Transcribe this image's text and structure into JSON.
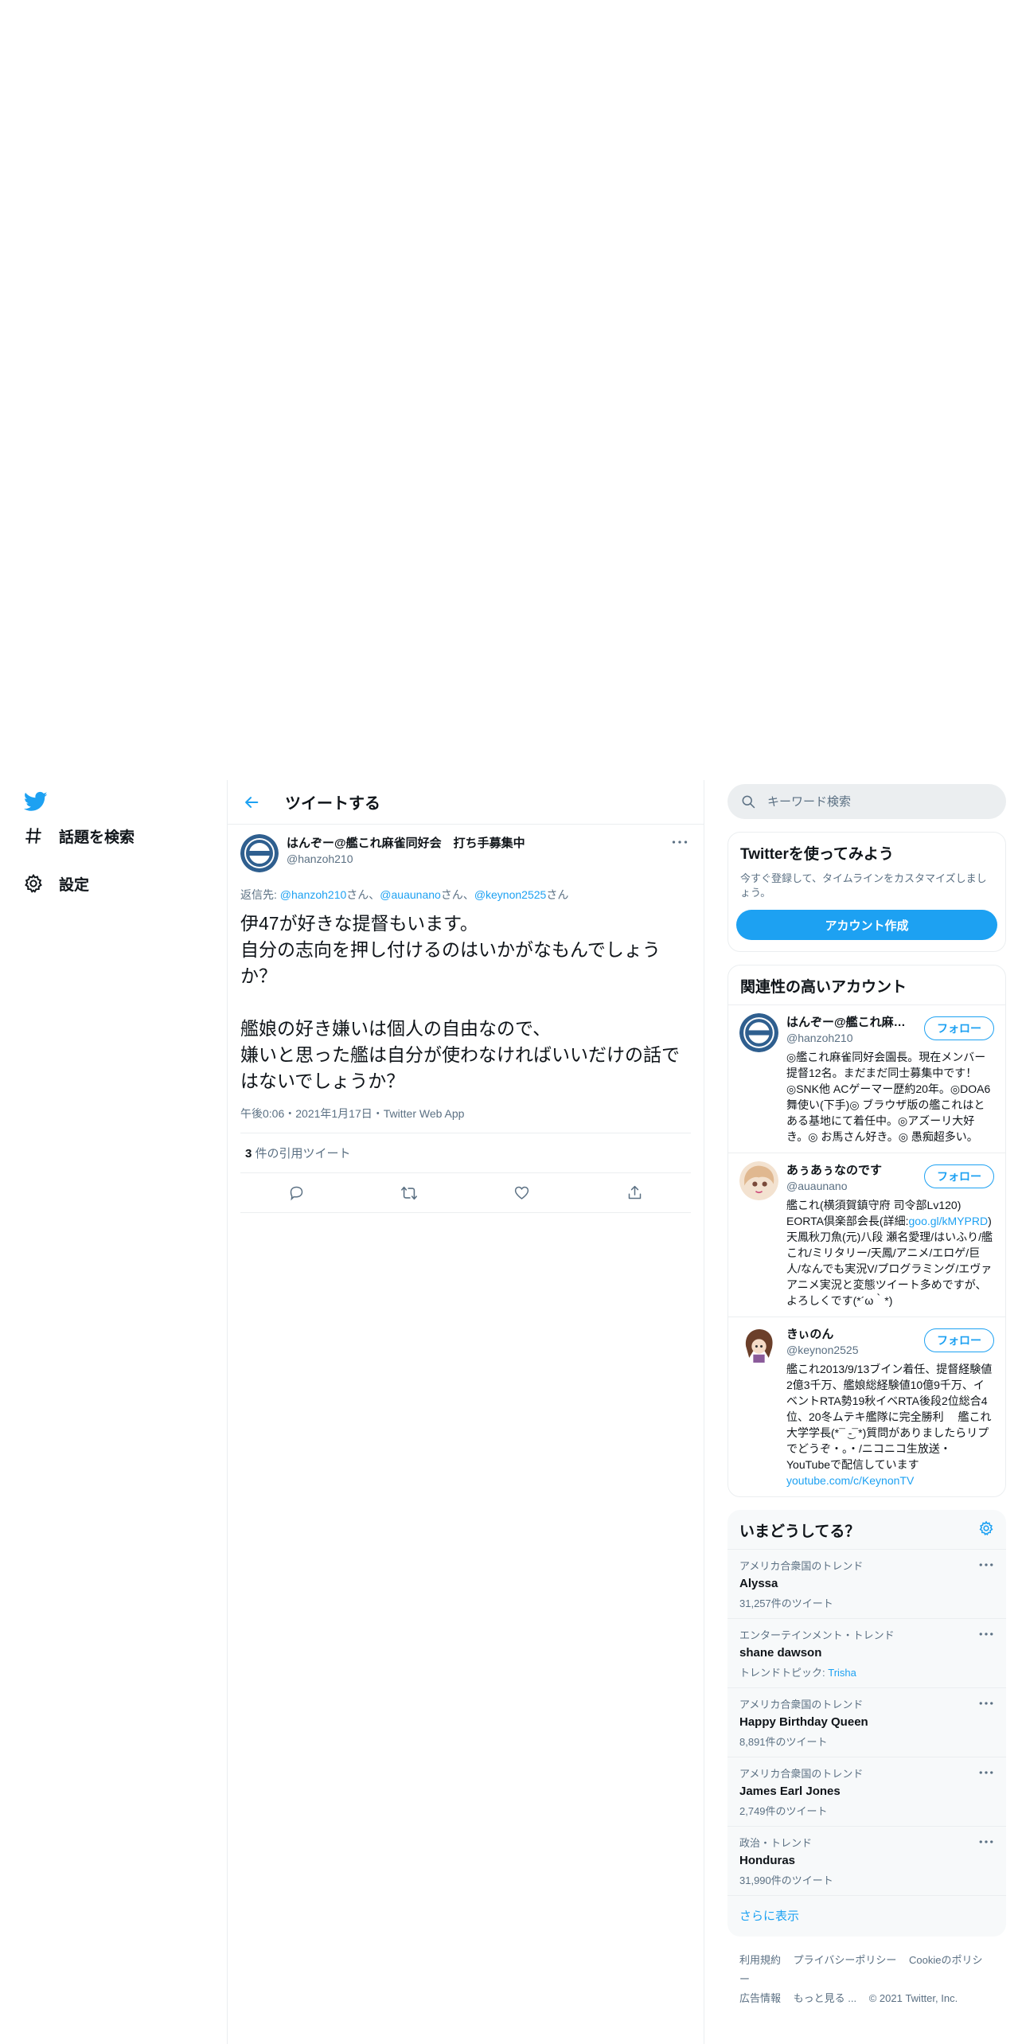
{
  "nav": {
    "explore_label": "話題を検索",
    "settings_label": "設定"
  },
  "header": {
    "title": "ツイートする"
  },
  "tweet": {
    "author_name": "はんぞー@艦これ麻雀同好会　打ち手募集中",
    "author_handle": "@hanzoh210",
    "reply_prefix": "返信先: ",
    "reply_users": [
      {
        "handle": "@hanzoh210",
        "suffix": "さん、"
      },
      {
        "handle": "@auaunano",
        "suffix": "さん、"
      },
      {
        "handle": "@keynon2525",
        "suffix": "さん"
      }
    ],
    "text": "伊47が好きな提督もいます。\n自分の志向を押し付けるのはいかがなもんでしょうか？\n\n艦娘の好き嫌いは個人の自由なので、\n嫌いと思った艦は自分が使わなければいいだけの話ではないでしょうか？",
    "meta": "午後0:06・2021年1月17日・Twitter Web App",
    "quote_count": "3",
    "quote_label": " 件の引用ツイート"
  },
  "search": {
    "placeholder": "キーワード検索"
  },
  "signup": {
    "title": "Twitterを使ってみよう",
    "desc": "今すぐ登録して、タイムラインをカスタマイズしましょう。",
    "button": "アカウント作成"
  },
  "related": {
    "title": "関連性の高いアカウント",
    "follow_label": "フォロー",
    "accounts": [
      {
        "name": "はんぞー@艦これ麻雀同好会　打ち手募集中",
        "handle": "@hanzoh210",
        "bio": "◎艦これ麻雀同好会園長。現在メンバー提督12名。まだまだ同士募集中です！◎SNK他 ACゲーマー歴約20年。◎DOA6 舞使い(下手)◎ ブラウザ版の艦これはとある基地にて着任中。◎アズーリ大好き。◎ お馬さん好き。◎ 愚痴超多い。"
      },
      {
        "name": "あぅあぅなのです",
        "handle": "@auaunano",
        "bio_a": "艦これ(横須賀鎮守府 司令部Lv120) EORTA倶楽部会長(詳細:",
        "bio_link": "goo.gl/kMYPRD",
        "bio_b": ") 天鳳秋刀魚(元)八段 瀬名愛理/はいふり/艦これ/ミリタリー/天鳳/アニメ/エロゲ/巨人/なんでも実況V/プログラミング/エヴァ アニメ実況と変態ツイート多めですが、よろしくです(*´ω｀*)"
      },
      {
        "name": "きぃのん",
        "handle": "@keynon2525",
        "bio_a": "艦これ2013/9/13ブイン着任、提督経験値2億3千万、艦娘総経験値10億9千万、イベントRTA勢19秋イベRTA後段2位総合4位、20冬ムテキ艦隊に完全勝利　 艦これ大学学長(*¯ ͜-¯*)質問がありましたらリプでどうぞ・。・/ニコニコ生放送・YouTubeで配信しています",
        "bio_link": "youtube.com/c/KeynonTV"
      }
    ]
  },
  "trends": {
    "title": "いまどうしてる？",
    "items": [
      {
        "context": "アメリカ合衆国のトレンド",
        "name": "Alyssa",
        "count": "31,257件のツイート"
      },
      {
        "context": "エンターテインメント・トレンド",
        "name": "shane dawson",
        "count_prefix": "トレンドトピック: ",
        "count_link": "Trisha"
      },
      {
        "context": "アメリカ合衆国のトレンド",
        "name": "Happy Birthday Queen",
        "count": "8,891件のツイート"
      },
      {
        "context": "アメリカ合衆国のトレンド",
        "name": "James Earl Jones",
        "count": "2,749件のツイート"
      },
      {
        "context": "政治・トレンド",
        "name": "Honduras",
        "count": "31,990件のツイート"
      }
    ],
    "show_more": "さらに表示"
  },
  "footer": {
    "links": [
      "利用規約",
      "プライバシーポリシー",
      "Cookieのポリシー",
      "広告情報",
      "もっと見る ..."
    ],
    "copyright": "© 2021 Twitter, Inc."
  },
  "colors": {
    "accent": "#1da1f2",
    "text": "#0f1419",
    "muted": "#5b7083"
  }
}
